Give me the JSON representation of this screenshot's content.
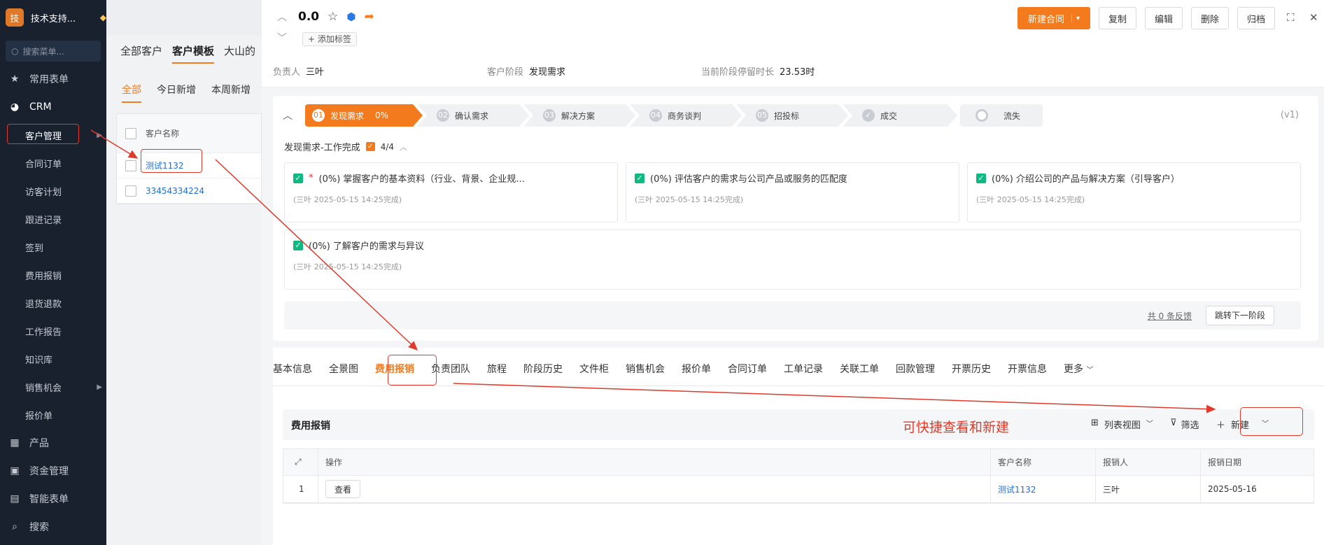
{
  "sidebar": {
    "logo": "技",
    "brand": "技术支持...",
    "search_placeholder": "搜索菜单...",
    "groups": [
      {
        "label": "常用表单",
        "icon": "star-icon"
      },
      {
        "label": "CRM",
        "icon": "pie-icon"
      }
    ],
    "crm_items": [
      "客户管理",
      "合同订单",
      "访客计划",
      "跟进记录",
      "签到",
      "费用报销",
      "退货退款",
      "工作报告",
      "知识库",
      "销售机会",
      "报价单"
    ],
    "bottom_groups": [
      {
        "label": "产品",
        "icon": "cube-icon"
      },
      {
        "label": "资金管理",
        "icon": "wallet-icon"
      },
      {
        "label": "智能表单",
        "icon": "form-icon"
      },
      {
        "label": "搜索",
        "icon": "search-icon"
      }
    ]
  },
  "bg": {
    "tabs": [
      "全部客户",
      "客户模板",
      "大山的"
    ],
    "filters": [
      "全部",
      "今日新增",
      "本周新增"
    ],
    "col_name": "客户名称",
    "rows": [
      "测试1132",
      "33454334224"
    ]
  },
  "record": {
    "title": "0.0",
    "add_tag": "+ 添加标签",
    "buttons": {
      "new_contract": "新建合同",
      "copy": "复制",
      "edit": "编辑",
      "delete": "删除",
      "archive": "归档"
    },
    "meta": {
      "owner_label": "负责人",
      "owner": "三叶",
      "stage_label": "客户阶段",
      "stage": "发现需求",
      "duration_label": "当前阶段停留时长",
      "duration": "23.53时"
    }
  },
  "stages": {
    "version": "(v1)",
    "items": [
      {
        "num": "01",
        "label": "发现需求",
        "pct": "0%"
      },
      {
        "num": "02",
        "label": "确认需求"
      },
      {
        "num": "03",
        "label": "解决方案"
      },
      {
        "num": "04",
        "label": "商务谈判"
      },
      {
        "num": "05",
        "label": "招投标"
      },
      {
        "num": "",
        "label": "成交"
      },
      {
        "num": "",
        "label": "流失"
      }
    ],
    "work_title": "发现需求-工作完成",
    "work_count": "4/4",
    "tasks": [
      {
        "text": "(0%)  掌握客户的基本资料（行业、背景、企业规...",
        "required": "*",
        "meta": "(三叶 2025-05-15 14:25完成)"
      },
      {
        "text": "(0%)  评估客户的需求与公司产品或服务的匹配度",
        "meta": "(三叶 2025-05-15 14:25完成)"
      },
      {
        "text": "(0%)  介绍公司的产品与解决方案（引导客户）",
        "meta": "(三叶 2025-05-15 14:25完成)"
      },
      {
        "text": "(0%)  了解客户的需求与异议",
        "meta": "(三叶 2025-05-15 14:25完成)"
      }
    ],
    "feedback": "共 0 条反馈",
    "next_stage": "跳转下一阶段"
  },
  "detail_tabs": [
    "基本信息",
    "全景图",
    "费用报销",
    "负责团队",
    "旅程",
    "阶段历史",
    "文件柜",
    "销售机会",
    "报价单",
    "合同订单",
    "工单记录",
    "关联工单",
    "回款管理",
    "开票历史",
    "开票信息",
    "更多"
  ],
  "expense": {
    "title": "费用报销",
    "annotation": "可快捷查看和新建",
    "view": "列表视图",
    "filter": "筛选",
    "new": "新建",
    "columns": [
      "操作",
      "客户名称",
      "报销人",
      "报销日期"
    ],
    "rows": [
      {
        "idx": "1",
        "action": "查看",
        "customer": "测试1132",
        "person": "三叶",
        "date": "2025-05-16"
      }
    ]
  },
  "colors": {
    "accent": "#f37b1d",
    "sidebar": "#19212f",
    "annotation": "#e03a2b",
    "link": "#1f6fd1"
  }
}
